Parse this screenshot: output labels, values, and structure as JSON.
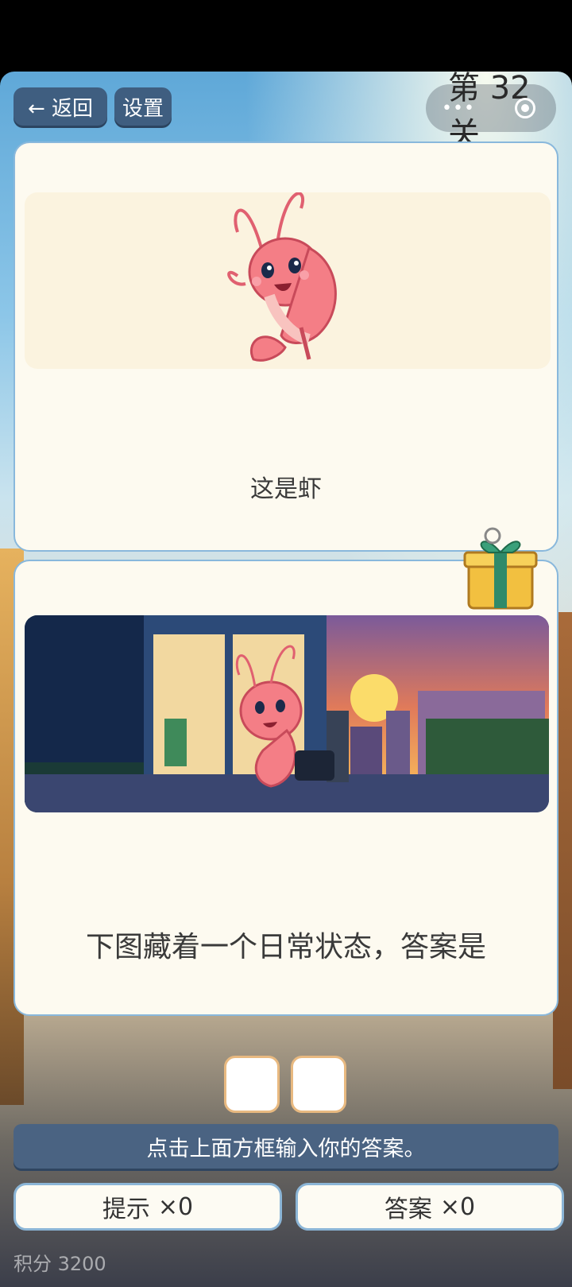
{
  "header": {
    "back_label": "← 返回",
    "settings_label": "设置",
    "level_title": "第 32 关",
    "capsule_icons": [
      "more-dots-icon",
      "target-icon"
    ]
  },
  "card1": {
    "image_icon": "shrimp-character-icon",
    "text": "这是虾"
  },
  "card2": {
    "image_icon": "shrimp-office-scene-icon",
    "text": "下图藏着一个日常状态，答案是",
    "gift_icon": "gift-box-icon"
  },
  "answer": {
    "box_count": 2
  },
  "instruction": "点击上面方框输入你的答案。",
  "buttons": {
    "hint_label": "提示",
    "hint_count": "×0",
    "answer_label": "答案",
    "answer_count": "×0"
  },
  "score_text": "积分 3200",
  "colors": {
    "button_dark": "#3f5e80",
    "card_bg": "#fdfaf0",
    "card_border": "#89b8dc",
    "answer_box_border": "#e8b980"
  }
}
